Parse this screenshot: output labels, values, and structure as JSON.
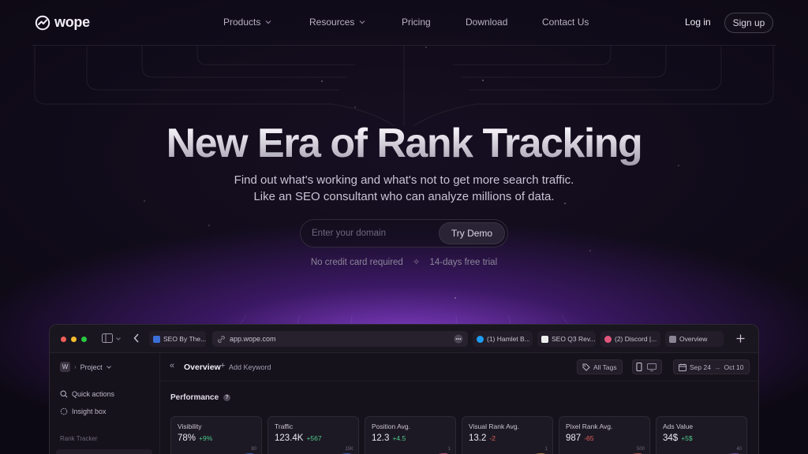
{
  "brand": {
    "name": "wope"
  },
  "nav": {
    "items": [
      {
        "label": "Products",
        "has_dropdown": true
      },
      {
        "label": "Resources",
        "has_dropdown": true
      },
      {
        "label": "Pricing",
        "has_dropdown": false
      },
      {
        "label": "Download",
        "has_dropdown": false
      },
      {
        "label": "Contact Us",
        "has_dropdown": false
      }
    ],
    "login": "Log in",
    "signup": "Sign up"
  },
  "hero": {
    "title": "New Era of Rank Tracking",
    "subtitle_line1": "Find out what's working and what's not to get more search traffic.",
    "subtitle_line2": "Like an SEO consultant who can analyze millions of data.",
    "domain_placeholder": "Enter your domain",
    "demo_button": "Try Demo",
    "note_left": "No credit card required",
    "note_right": "14-days free trial"
  },
  "app": {
    "address": "app.wope.com",
    "tabs": [
      {
        "label": "SEO By The...",
        "icon_color": "#3a6fd8"
      },
      {
        "label": "(1) Hamlet B...",
        "icon_color": "#1d9bf0"
      },
      {
        "label": "SEO Q3 Rev...",
        "icon_color": "#eeeeee"
      },
      {
        "label": "(2) Discord |...",
        "icon_color": "#e0567c"
      },
      {
        "label": "Overview",
        "icon_color": "#8a8494"
      }
    ],
    "sidebar": {
      "project": "Project",
      "project_initial": "W",
      "items": [
        "Quick actions",
        "Insight box"
      ],
      "section": "Rank Tracker"
    },
    "toolbar": {
      "title": "Overview",
      "add_keyword": "Add Keyword",
      "tags": "All Tags",
      "date_from": "Sep 24",
      "date_to": "Oct 10"
    },
    "performance_label": "Performance",
    "cards": [
      {
        "label": "Visibility",
        "value": "78%",
        "change": "+9%",
        "trend": "up",
        "max": "80"
      },
      {
        "label": "Traffic",
        "value": "123.4K",
        "change": "+567",
        "trend": "up",
        "max": "15K"
      },
      {
        "label": "Position Avg.",
        "value": "12.3",
        "change": "+4.5",
        "trend": "up",
        "max": "1"
      },
      {
        "label": "Visual Rank Avg.",
        "value": "13.2",
        "change": "-2",
        "trend": "down",
        "max": "1"
      },
      {
        "label": "Pixel Rank Avg.",
        "value": "987",
        "change": "-65",
        "trend": "down",
        "max": "500"
      },
      {
        "label": "Ads Value",
        "value": "34$",
        "change": "+5$",
        "trend": "up",
        "max": "40"
      }
    ]
  },
  "colors": {
    "background": "#0d0914",
    "glow": "#9646e6",
    "positive": "#4ec98a",
    "negative": "#e0605e"
  }
}
